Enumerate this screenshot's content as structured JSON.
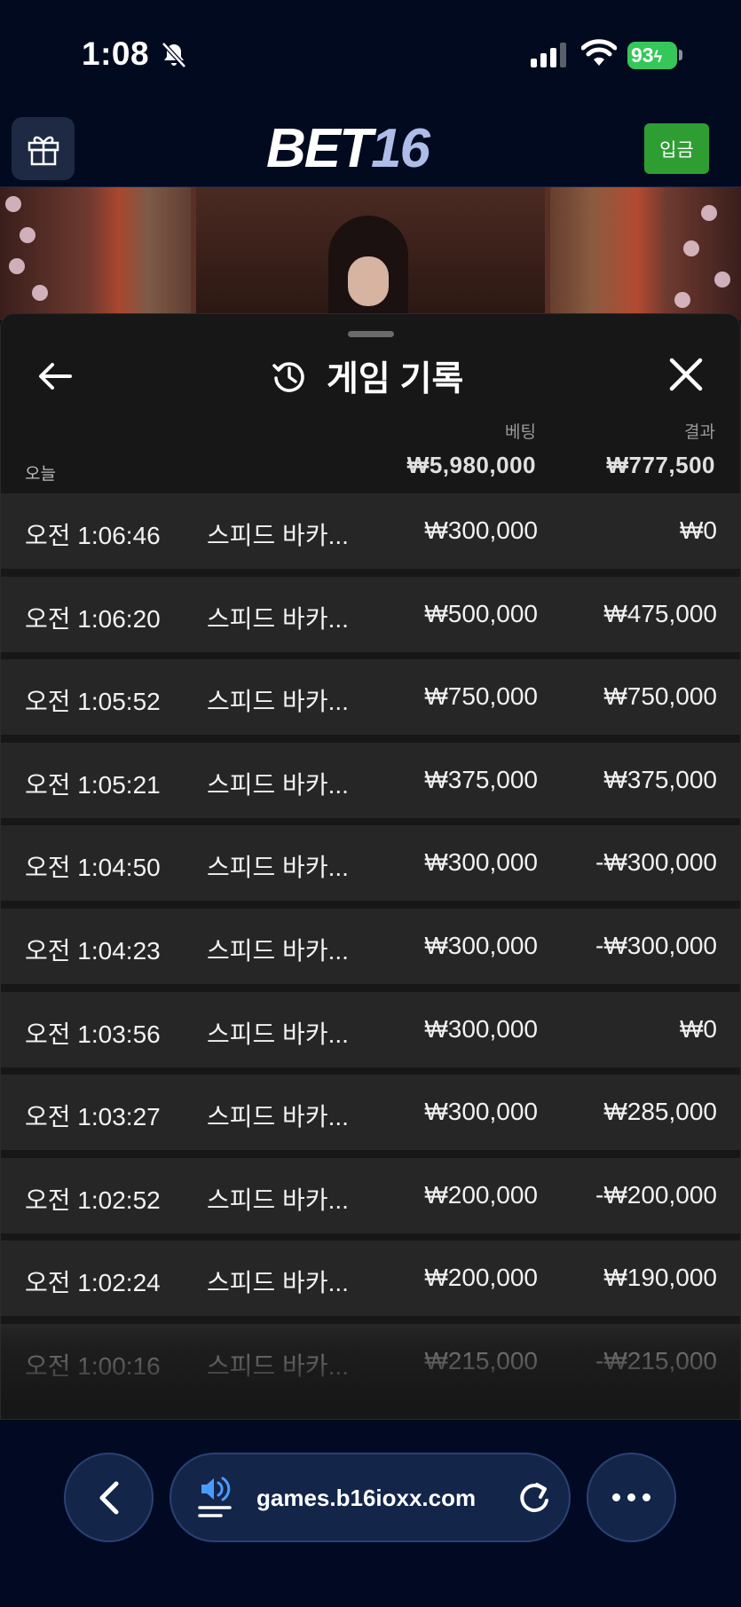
{
  "status_bar": {
    "time": "1:08",
    "battery": "93"
  },
  "header": {
    "logo_part1": "BET",
    "logo_part2": "16",
    "deposit_label": "입금"
  },
  "panel": {
    "title": "게임 기록",
    "col_bet": "베팅",
    "col_result": "결과",
    "today_label": "오늘",
    "total_bet": "₩5,980,000",
    "total_result": "₩777,500",
    "rows": [
      {
        "time": "오전 1:06:46",
        "game": "스피드 바카...",
        "bet": "₩300,000",
        "result": "₩0"
      },
      {
        "time": "오전 1:06:20",
        "game": "스피드 바카...",
        "bet": "₩500,000",
        "result": "₩475,000"
      },
      {
        "time": "오전 1:05:52",
        "game": "스피드 바카...",
        "bet": "₩750,000",
        "result": "₩750,000"
      },
      {
        "time": "오전 1:05:21",
        "game": "스피드 바카...",
        "bet": "₩375,000",
        "result": "₩375,000"
      },
      {
        "time": "오전 1:04:50",
        "game": "스피드 바카...",
        "bet": "₩300,000",
        "result": "-₩300,000"
      },
      {
        "time": "오전 1:04:23",
        "game": "스피드 바카...",
        "bet": "₩300,000",
        "result": "-₩300,000"
      },
      {
        "time": "오전 1:03:56",
        "game": "스피드 바카...",
        "bet": "₩300,000",
        "result": "₩0"
      },
      {
        "time": "오전 1:03:27",
        "game": "스피드 바카...",
        "bet": "₩300,000",
        "result": "₩285,000"
      },
      {
        "time": "오전 1:02:52",
        "game": "스피드 바카...",
        "bet": "₩200,000",
        "result": "-₩200,000"
      },
      {
        "time": "오전 1:02:24",
        "game": "스피드 바카...",
        "bet": "₩200,000",
        "result": "₩190,000"
      },
      {
        "time": "오전 1:00:16",
        "game": "스피드 바카...",
        "bet": "₩215,000",
        "result": "-₩215,000"
      }
    ]
  },
  "browser": {
    "url": "games.b16ioxx.com"
  },
  "icons": {
    "status": [
      "bell-slash-icon",
      "signal-icon",
      "wifi-icon"
    ],
    "header": [
      "gift-icon"
    ],
    "panel": [
      "arrow-left-icon",
      "history-icon",
      "close-icon"
    ],
    "browser": [
      "chevron-left-icon",
      "speaker-icon",
      "reload-icon",
      "more-icon"
    ]
  },
  "colors": {
    "deposit": "#2e9e33",
    "battery": "#35c759",
    "background": "#020a1f",
    "panel": "#171717",
    "row": "#262626"
  }
}
